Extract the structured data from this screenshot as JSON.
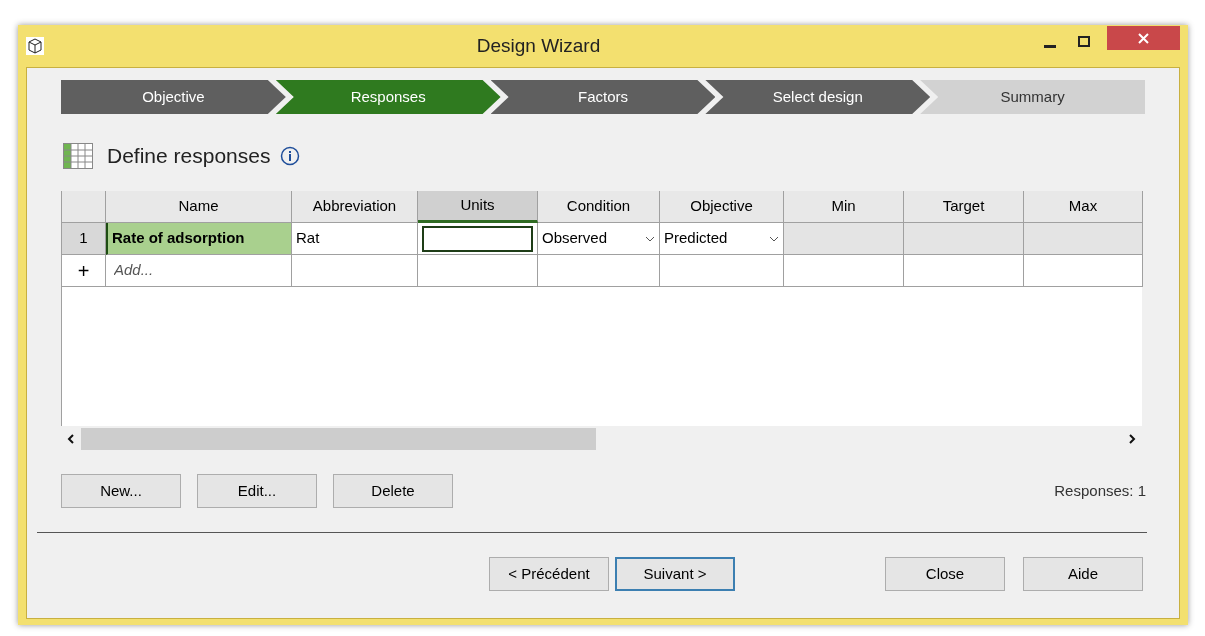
{
  "window": {
    "title": "Design Wizard"
  },
  "steps": [
    {
      "label": "Objective",
      "selected": false,
      "available": true
    },
    {
      "label": "Responses",
      "selected": true,
      "available": true
    },
    {
      "label": "Factors",
      "selected": false,
      "available": true
    },
    {
      "label": "Select design",
      "selected": false,
      "available": true
    },
    {
      "label": "Summary",
      "selected": false,
      "available": false
    }
  ],
  "heading": "Define responses",
  "table": {
    "columns": [
      "Name",
      "Abbreviation",
      "Units",
      "Condition",
      "Objective",
      "Min",
      "Target",
      "Max"
    ],
    "rows": [
      {
        "number": "1",
        "cells": [
          {
            "kind": "text",
            "value": "Rate of adsorption",
            "selected": true
          },
          {
            "kind": "text",
            "value": "Rat",
            "selected": false
          },
          {
            "kind": "input",
            "focused": true
          },
          {
            "kind": "dropdown",
            "value": "Observed"
          },
          {
            "kind": "dropdown",
            "value": "Predicted"
          },
          {
            "kind": "disabled"
          },
          {
            "kind": "disabled"
          },
          {
            "kind": "disabled"
          }
        ]
      }
    ],
    "add_row": {
      "icon": "+",
      "placeholder": "Add..."
    }
  },
  "buttons": [
    "New...",
    "Edit...",
    "Delete"
  ],
  "count": "Responses: 1",
  "footer_buttons": [
    {
      "label": "< Précédent",
      "selected": false
    },
    {
      "label": "Suivant >",
      "selected": true
    },
    {
      "label": "Close",
      "selected": false
    },
    {
      "label": "Aide",
      "selected": false
    }
  ]
}
